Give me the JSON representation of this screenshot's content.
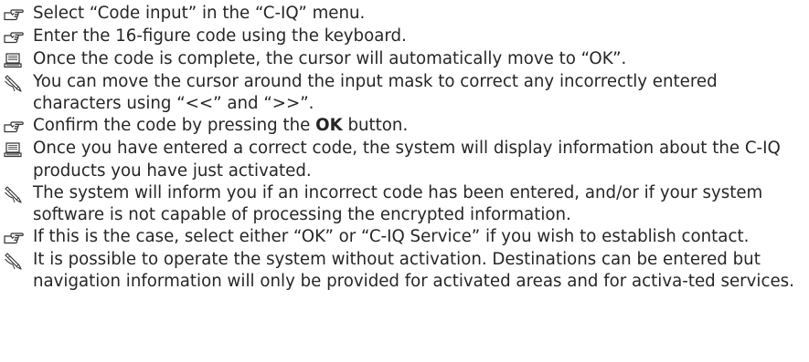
{
  "items": [
    {
      "icon": "pointing-hand-icon",
      "parts": [
        {
          "t": "Select “Code input” in the “C-IQ” menu."
        }
      ]
    },
    {
      "icon": "pointing-hand-icon",
      "parts": [
        {
          "t": "Enter the 16-figure code using the keyboard."
        }
      ]
    },
    {
      "icon": "laptop-icon",
      "parts": [
        {
          "t": "Once the code is complete, the cursor will automatically move to “OK”."
        }
      ]
    },
    {
      "icon": "pencil-note-icon",
      "parts": [
        {
          "t": "You can move the cursor around the input mask to correct any incorrectly entered characters using “<<” and “>>”."
        }
      ]
    },
    {
      "icon": "pointing-hand-icon",
      "parts": [
        {
          "t": "Confirm the code by pressing the "
        },
        {
          "t": "OK",
          "b": true
        },
        {
          "t": " button."
        }
      ]
    },
    {
      "icon": "laptop-icon",
      "parts": [
        {
          "t": "Once you have entered a correct code, the system will display information about the C-IQ products you have just activated."
        }
      ]
    },
    {
      "icon": "pencil-note-icon",
      "parts": [
        {
          "t": "The system will inform you if an incorrect code has been entered, and/or if your system software is not capable of processing the encrypted information."
        }
      ]
    },
    {
      "icon": "pointing-hand-icon",
      "parts": [
        {
          "t": "If this is the case, select either “OK” or “C-IQ Service” if you wish to establish contact."
        }
      ]
    },
    {
      "icon": "pencil-note-icon",
      "parts": [
        {
          "t": "It is possible to operate the system without activation. Destinations can be entered but navigation information will only be provided for activated areas and for activa-ted services."
        }
      ]
    }
  ]
}
